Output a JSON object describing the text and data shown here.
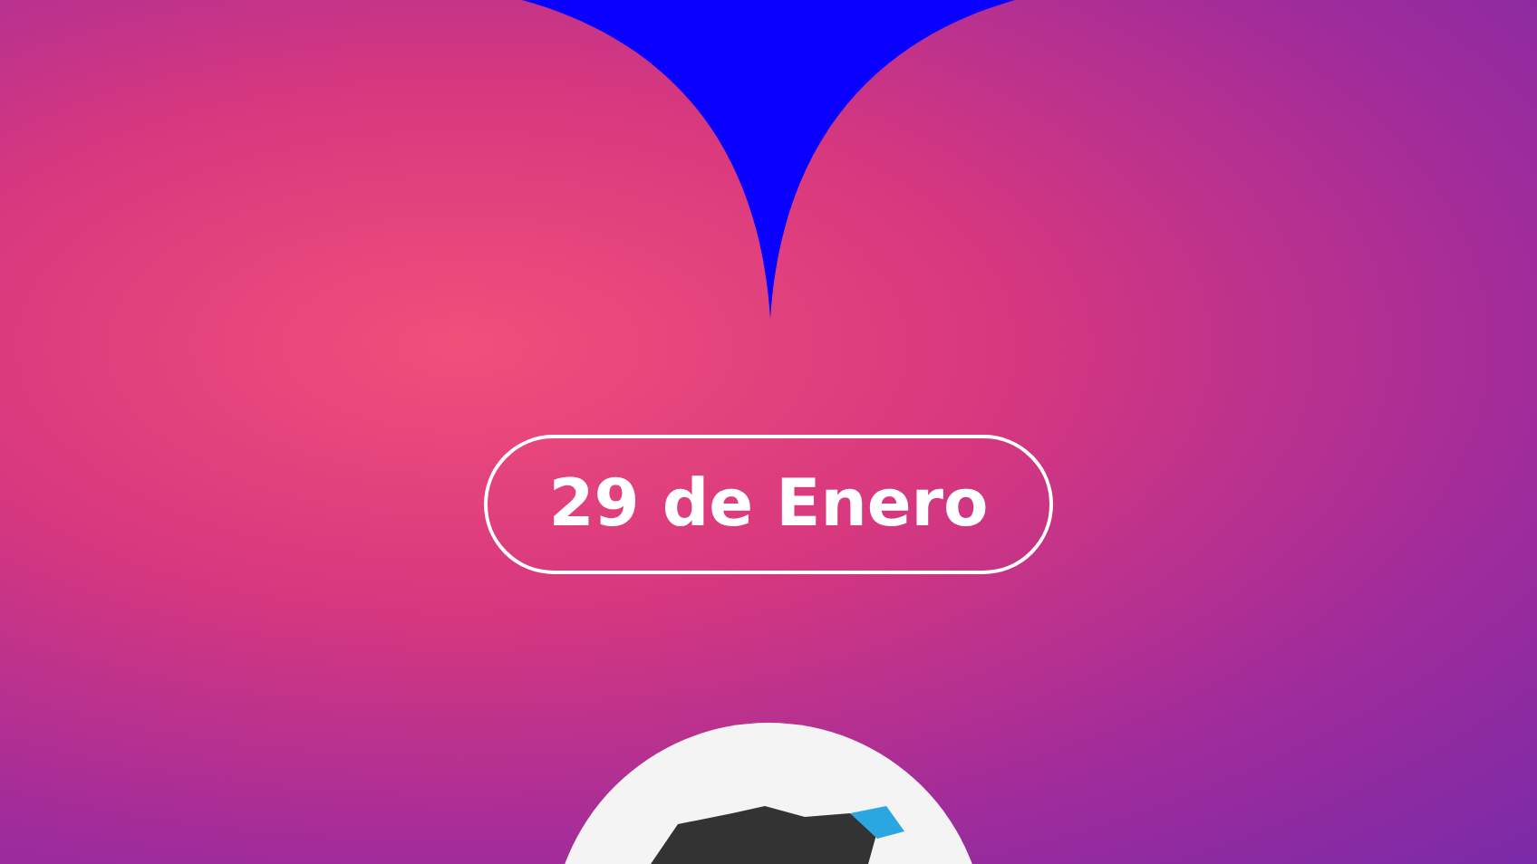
{
  "date_badge": {
    "text": "29 de Enero"
  }
}
